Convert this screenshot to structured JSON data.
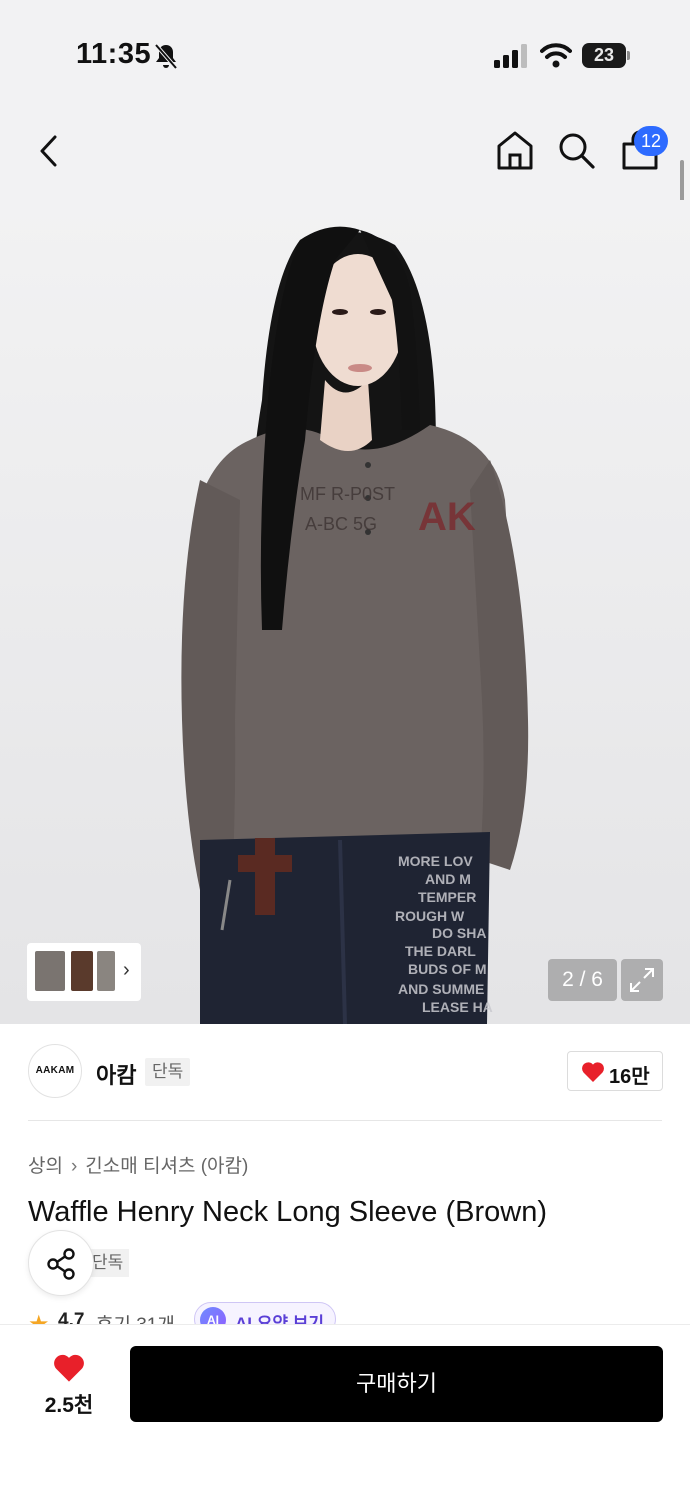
{
  "status_bar": {
    "time": "11:35",
    "battery": "23"
  },
  "nav": {
    "bag_count": "12"
  },
  "gallery": {
    "counter": "2 / 6",
    "thumb_colors": [
      "#7a7470",
      "#5a3a2c",
      "#8a8580"
    ]
  },
  "brand": {
    "logo_text": "AAKAM",
    "name": "아캄",
    "tag": "단독",
    "likes": "16만"
  },
  "breadcrumb": {
    "category": "상의",
    "subcategory": "긴소매 티셔츠 (아캄)"
  },
  "product": {
    "title": "Waffle Henry Neck Long Sleeve (Brown)",
    "tag": "단독",
    "rating": "4.7",
    "reviews": "후기 31개",
    "ai_badge": "AI",
    "ai_label": "AI 요약 보기"
  },
  "bottom": {
    "wish_count": "2.5천",
    "buy_label": "구매하기"
  },
  "colors": {
    "accent_blue": "#2d6bff",
    "heart_red": "#e8202a",
    "buy_black": "#000000"
  }
}
